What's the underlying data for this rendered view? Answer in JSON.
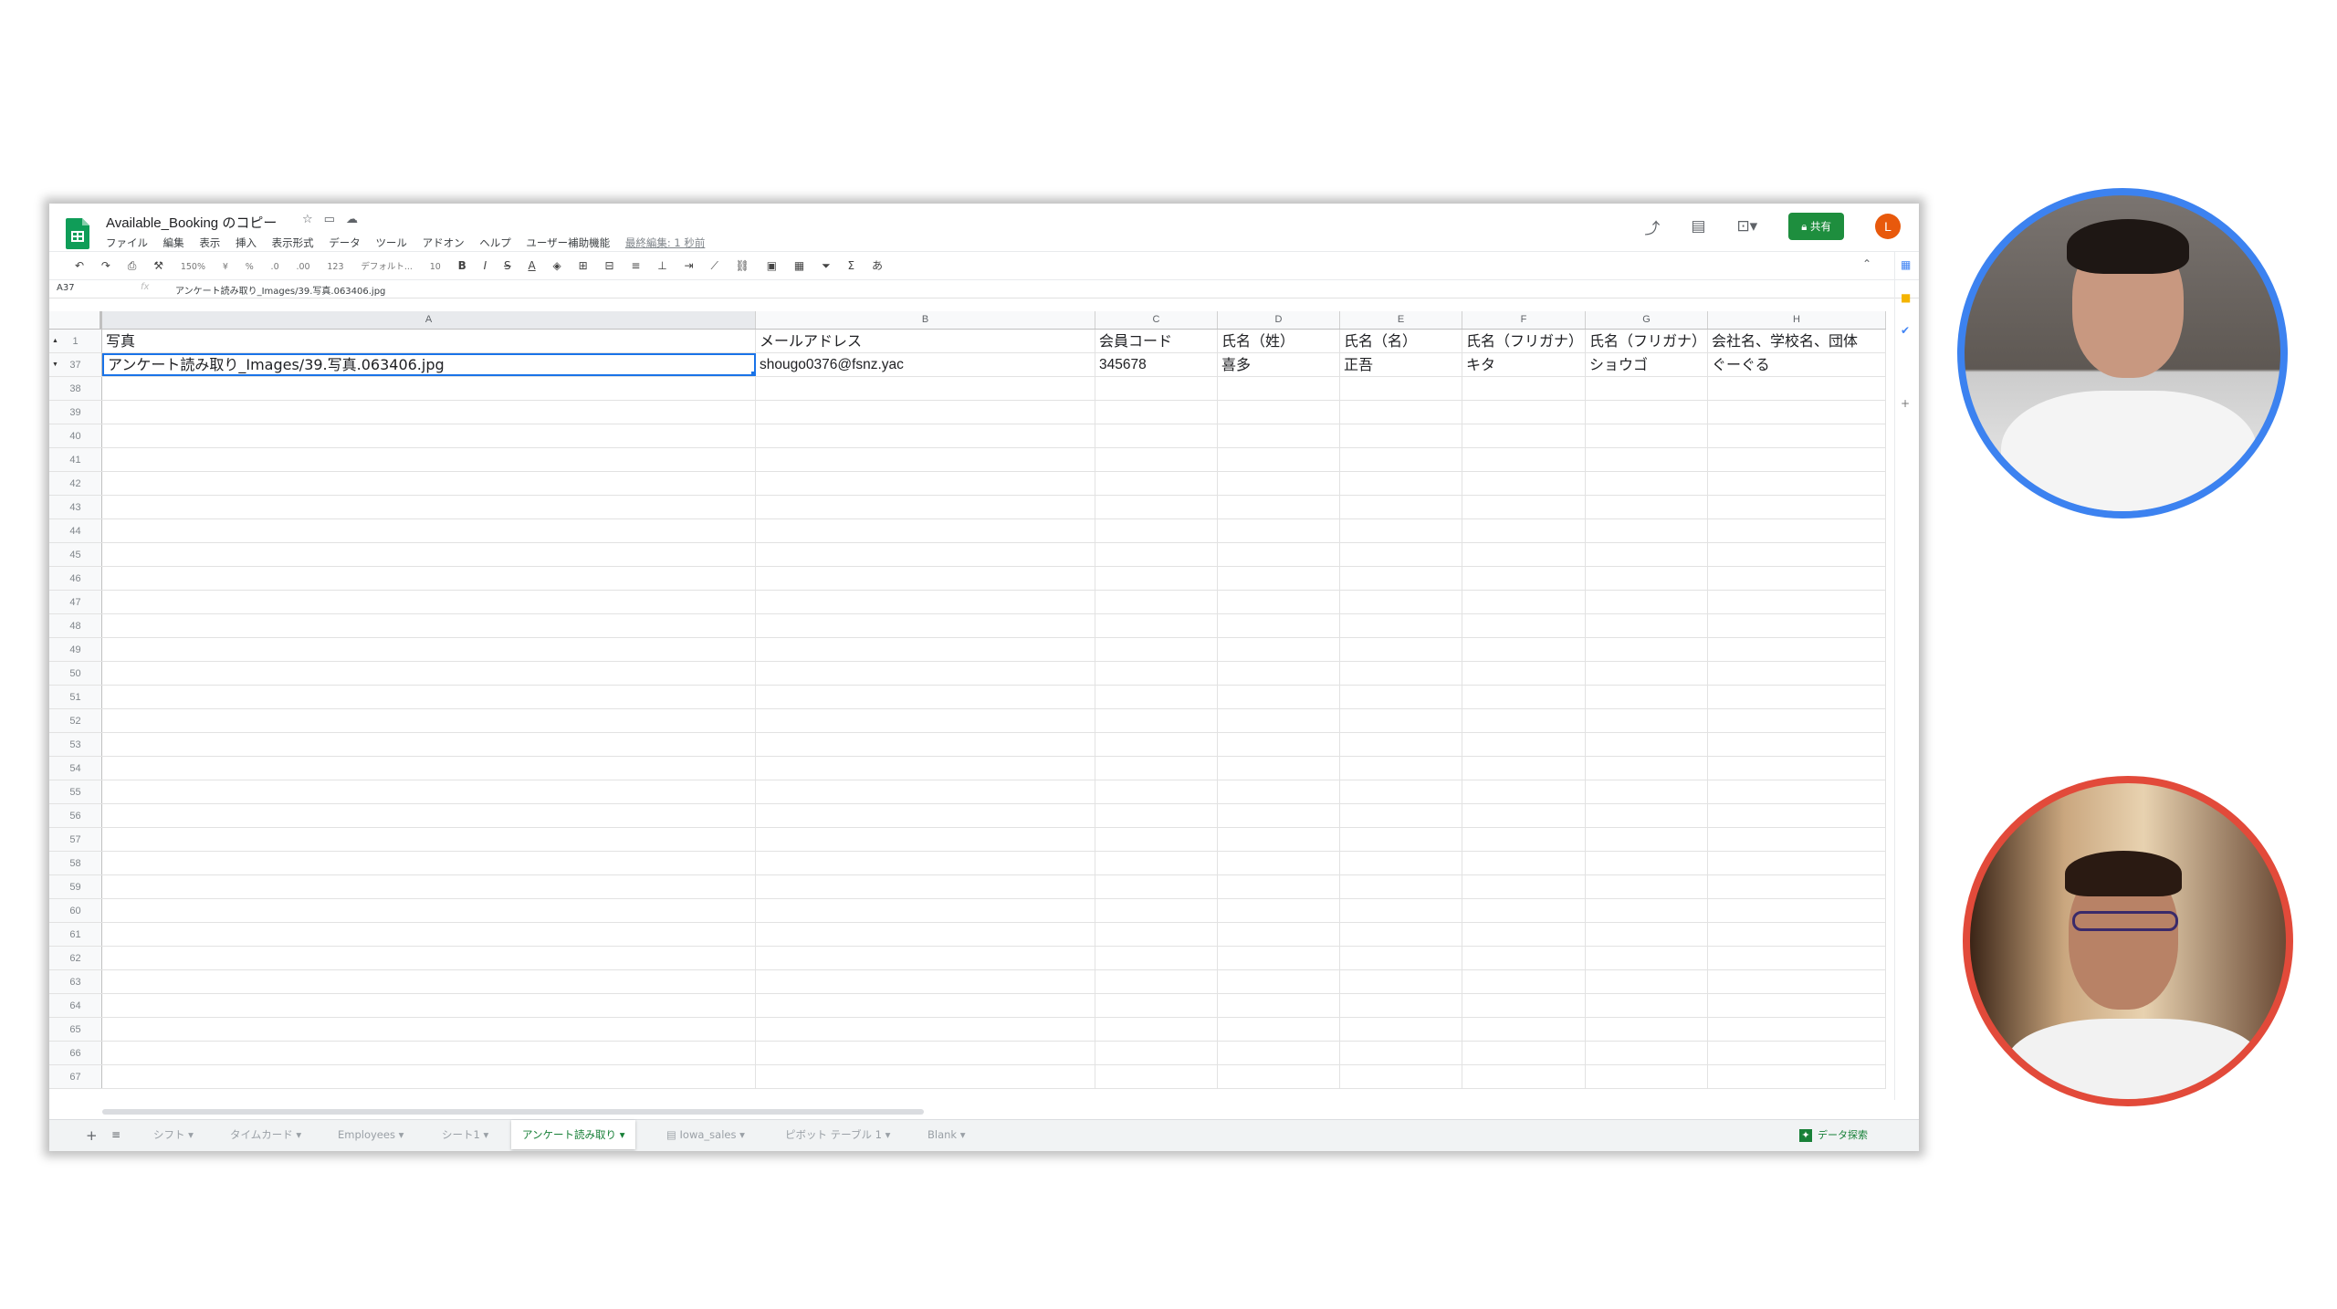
{
  "spreadsheet": {
    "title": "Available_Booking のコピー",
    "menu": [
      "ファイル",
      "編集",
      "表示",
      "挿入",
      "表示形式",
      "データ",
      "ツール",
      "アドオン",
      "ヘルプ",
      "ユーザー補助機能"
    ],
    "last_edit": "最終編集: 1 秒前",
    "share_label": "共有",
    "user_initial": "L",
    "toolbar": {
      "zoom": "150%",
      "currency": "¥",
      "percent": "%",
      "dec_less": ".0",
      "dec_more": ".00",
      "format_more": "123",
      "font": "デフォルト...",
      "font_size": "10"
    },
    "name_box": "A37",
    "formula": "アンケート読み取り_Images/39.写真.063406.jpg",
    "columns": [
      "A",
      "B",
      "C",
      "D",
      "E",
      "F",
      "G",
      "H"
    ],
    "header_row": {
      "number": "1",
      "cells": [
        "写真",
        "メールアドレス",
        "会員コード",
        "氏名（姓）",
        "氏名（名）",
        "氏名（フリガナ）",
        "氏名（フリガナ）",
        "会社名、学校名、団体"
      ]
    },
    "data_row": {
      "number": "37",
      "cells": [
        "アンケート読み取り_Images/39.写真.063406.jpg",
        "shougo0376@fsnz.yac",
        "345678",
        "喜多",
        "正吾",
        "キタ",
        "ショウゴ",
        "ぐーぐる"
      ]
    },
    "empty_rows": [
      "38",
      "39",
      "40",
      "41",
      "42",
      "43",
      "44",
      "45",
      "46",
      "47",
      "48",
      "49",
      "50",
      "51",
      "52",
      "53",
      "54",
      "55",
      "56",
      "57",
      "58",
      "59",
      "60",
      "61",
      "62",
      "63",
      "64",
      "65",
      "66",
      "67"
    ],
    "sheet_tabs": [
      "シフト",
      "タイムカード",
      "Employees",
      "シート1",
      "アンケート読み取り",
      "Iowa_sales",
      "ピボット テーブル 1",
      "Blank"
    ],
    "active_tab": "アンケート読み取り",
    "explore_label": "データ探索"
  },
  "video_call": {
    "participants": [
      {
        "ring_color": "#3c82f0"
      },
      {
        "ring_color": "#e24a3a"
      }
    ]
  }
}
